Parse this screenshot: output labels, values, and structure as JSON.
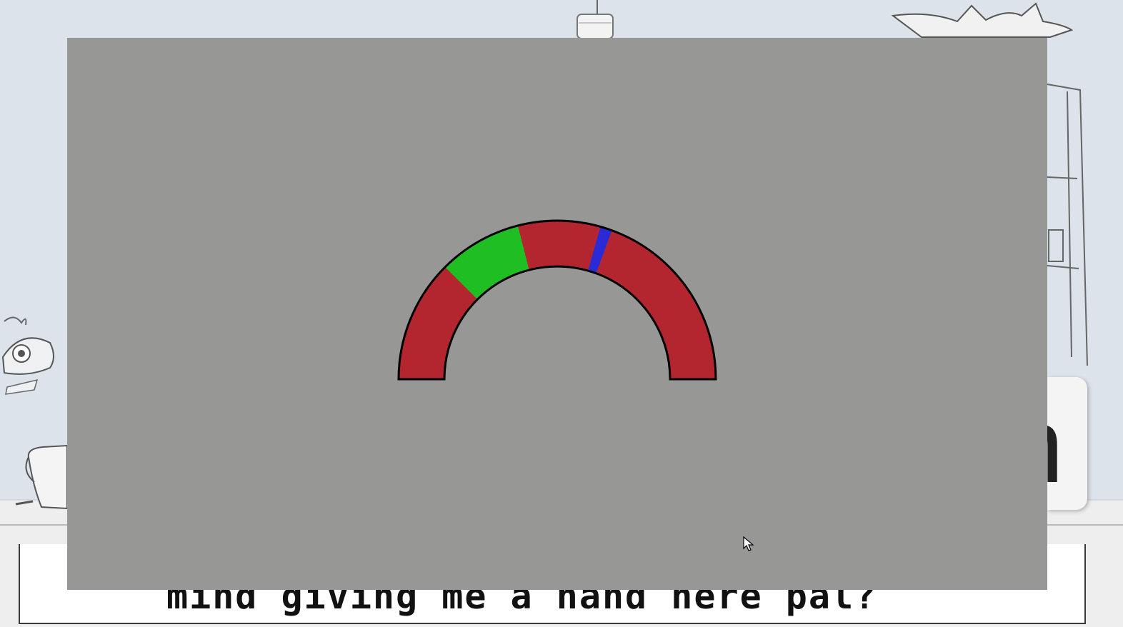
{
  "dialog": {
    "text": "mind giving me a hand here pal?"
  },
  "side_tile": {
    "letter": "n"
  },
  "minigame": {
    "gauge": {
      "bar_color": "#b3262f",
      "target_zone_color": "#1fbf24",
      "needle_color": "#2a2ad6",
      "target_zone_start_fraction": 0.25,
      "target_zone_end_fraction": 0.42,
      "needle_fraction": 0.6
    },
    "overlay_color": "#979796"
  }
}
